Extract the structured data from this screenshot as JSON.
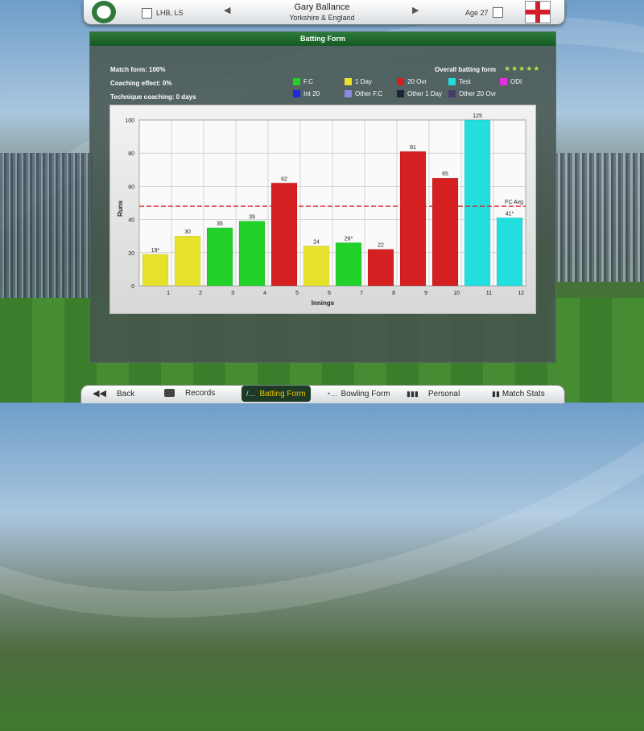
{
  "header": {
    "player_name": "Gary Ballance",
    "batting_style": "LHB, LS",
    "team": "Yorkshire & England",
    "age": "Age 27"
  },
  "panel": {
    "title": "Batting Form",
    "match_form": "Match form: 100%",
    "coaching_effect": "Coaching effect: 0%",
    "technique_coaching": "Technique coaching: 0 days",
    "overall_label": "Overall batting form",
    "overall_stars": "★★★★★"
  },
  "legend": [
    {
      "label": "F.C",
      "color": "#22d02a"
    },
    {
      "label": "1 Day",
      "color": "#e6e22c"
    },
    {
      "label": "20 Ovr",
      "color": "#d42020"
    },
    {
      "label": "Test",
      "color": "#22dede"
    },
    {
      "label": "ODI",
      "color": "#e030e0"
    },
    {
      "label": "Int 20",
      "color": "#1e2ae0"
    },
    {
      "label": "Other F.C",
      "color": "#8a8ae0"
    },
    {
      "label": "Other 1 Day",
      "color": "#20203a"
    },
    {
      "label": "Other 20 Ovr",
      "color": "#4a3a6a"
    }
  ],
  "chart_data": {
    "type": "bar",
    "xlabel": "Innings",
    "ylabel": "Runs",
    "ylim": [
      0,
      100
    ],
    "yticks": [
      0,
      20,
      40,
      60,
      80,
      100
    ],
    "grid": true,
    "categories": [
      "1",
      "2",
      "3",
      "4",
      "5",
      "6",
      "7",
      "8",
      "9",
      "10",
      "11",
      "12"
    ],
    "values": [
      19,
      30,
      35,
      39,
      62,
      24,
      26,
      22,
      81,
      65,
      125,
      41
    ],
    "labels": [
      "19*",
      "30",
      "35",
      "39",
      "62",
      "24",
      "26*",
      "22",
      "81",
      "65",
      "125",
      "41*"
    ],
    "formats": [
      "1 Day",
      "1 Day",
      "F.C",
      "F.C",
      "20 Ovr",
      "1 Day",
      "F.C",
      "20 Ovr",
      "20 Ovr",
      "20 Ovr",
      "Test",
      "Test"
    ],
    "reference_line": {
      "label": "FC Avg",
      "value": 48,
      "color": "#dd2222"
    }
  },
  "footer": {
    "back": "Back",
    "records": "Records",
    "batting_form": "Batting Form",
    "bowling_form": "Bowling Form",
    "personal": "Personal",
    "match_stats": "Match Stats"
  }
}
